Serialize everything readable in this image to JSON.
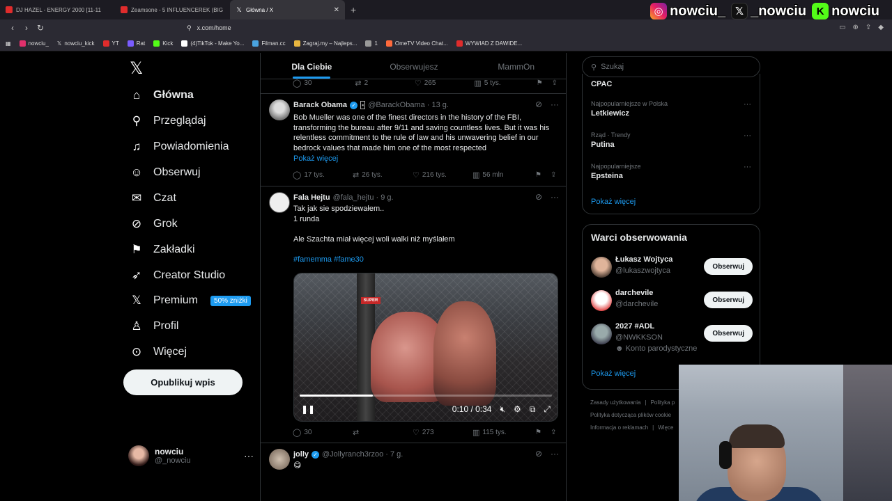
{
  "browser": {
    "tabs": [
      {
        "label": "DJ HAZEL - ENERGY 2000 [11-11"
      },
      {
        "label": "Zeamsone - 5 INFLUENCEREK (BIG B"
      },
      {
        "label": "Główna / X"
      }
    ],
    "url": "x.com/home",
    "bookmarks": [
      "nowciu_",
      "nowciu_kick",
      "YT",
      "Rat",
      "Kick",
      "(4)TikTok - Make Yo...",
      "Filman.cc",
      "Zagraj.my – Najleps...",
      "1",
      "OmeTV Video Chat...",
      "WYWIAD Z DAWIDE..."
    ]
  },
  "stream_overlay": {
    "names": [
      "nowciu_",
      "_nowciu",
      "nowciu"
    ],
    "icons": [
      "instagram-icon",
      "x-icon",
      "kick-icon"
    ]
  },
  "nav": {
    "items": [
      {
        "label": "Główna",
        "icon": "home-icon"
      },
      {
        "label": "Przeglądaj",
        "icon": "search-icon"
      },
      {
        "label": "Powiadomienia",
        "icon": "bell-icon"
      },
      {
        "label": "Obserwuj",
        "icon": "follow-icon"
      },
      {
        "label": "Czat",
        "icon": "mail-icon"
      },
      {
        "label": "Grok",
        "icon": "grok-icon"
      },
      {
        "label": "Zakładki",
        "icon": "bookmark-icon"
      },
      {
        "label": "Creator Studio",
        "icon": "rocket-icon"
      },
      {
        "label": "Premium",
        "icon": "x-icon"
      },
      {
        "label": "Profil",
        "icon": "person-icon"
      },
      {
        "label": "Więcej",
        "icon": "more-icon"
      }
    ],
    "premium_badge": "50% zniżki",
    "post_button": "Opublikuj wpis",
    "profile": {
      "name": "nowciu",
      "handle": "@_nowciu"
    }
  },
  "feed": {
    "tabs": [
      "Dla Ciebie",
      "Obserwujesz",
      "MammOn"
    ],
    "top_actions": {
      "replies": "30",
      "reposts": "2",
      "likes": "265",
      "views": "5 tys."
    },
    "tweets": [
      {
        "name": "Barack Obama",
        "handle": "@BarackObama · 13 g.",
        "text": "Bob Mueller was one of the finest directors in the history of the FBI, transforming the bureau after 9/11 and saving countless lives. But it was his relentless commitment to the rule of law and his unwavering belief in our bedrock values that made him one of the most respected",
        "show_more": "Pokaż więcej",
        "replies": "17 tys.",
        "reposts": "26 tys.",
        "likes": "216 tys.",
        "views": "56 mln"
      },
      {
        "name": "Fala Hejtu",
        "handle": "@fala_hejtu · 9 g.",
        "line1": "Tak jak sie spodziewałem..",
        "line2": "1 runda",
        "line3": "Ale Szachta miał więcej woli walki niż myślałem",
        "hashtags": "#famemma #fame30",
        "video": {
          "time": "0:10 / 0:34",
          "progress": 0.29,
          "sign": "SUPER"
        },
        "replies": "30",
        "reposts": "",
        "likes": "273",
        "views": "115 tys."
      },
      {
        "name": "jolly",
        "handle": "@Jollyranch3rzoo · 7 g.",
        "text": "😋"
      }
    ]
  },
  "right": {
    "search_placeholder": "Szukaj",
    "trends": [
      {
        "context": "",
        "name": "CPAC"
      },
      {
        "context": "Najpopularniejsze w Polska",
        "name": "Letkiewicz"
      },
      {
        "context": "Rząd · Trendy",
        "name": "Putina"
      },
      {
        "context": "Najpopularniejsze",
        "name": "Epsteina"
      }
    ],
    "show_more": "Pokaż więcej",
    "follow_title": "Warci obserwowania",
    "follow": [
      {
        "name": "Łukasz Wojtyca",
        "handle": "@lukaszwojtyca",
        "note": ""
      },
      {
        "name": "darchevile",
        "handle": "@darchevile",
        "note": ""
      },
      {
        "name": "2027 #ADL",
        "handle": "@NWKKSON",
        "note": "Konto parodystyczne"
      }
    ],
    "follow_button": "Obserwuj",
    "footer": [
      "Zasady użytkowania",
      "Polityka p",
      "Polityka dotycząca plików cookie",
      "Informacja o reklamach",
      "Więce"
    ]
  }
}
